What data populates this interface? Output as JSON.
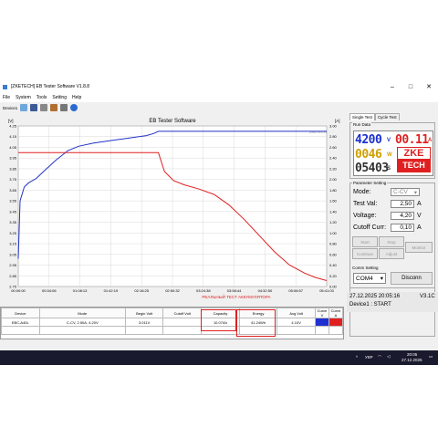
{
  "window": {
    "title": "[ZKETECH] EB Tester Software V1.8.8"
  },
  "menu": [
    "File",
    "System",
    "Tools",
    "Setting",
    "Help"
  ],
  "toolbar": {
    "device_label": "Device1"
  },
  "chart": {
    "title": "EB Tester Software",
    "watermark": "ZKETECH",
    "left_unit": "[V]",
    "right_unit": "[A]",
    "overlay_text": "РЕАЛЬНЫЙ ТЕСТ АККУМУЛЯТОРА",
    "colors": {
      "voltage": "#2233c8",
      "current": "#e02020",
      "grid": "#d0d0d0"
    }
  },
  "chart_data": {
    "type": "line",
    "title": "EB Tester Software",
    "x_ticks": [
      "00:00:00",
      "00:34:06",
      "01:08:13",
      "01:42:19",
      "02:16:25",
      "02:50:32",
      "03:24:38",
      "03:58:44",
      "04:32:50",
      "05:06:57",
      "05:41:03"
    ],
    "x_range_seconds": [
      0,
      20463
    ],
    "y_left_ticks": [
      "4.25",
      "4.15",
      "4.05",
      "3.95",
      "3.85",
      "3.75",
      "3.65",
      "3.55",
      "3.45",
      "3.35",
      "3.25",
      "3.15",
      "3.05",
      "2.95",
      "2.85",
      "2.75"
    ],
    "y_left_range": [
      2.75,
      4.25
    ],
    "y_right_ticks": [
      "3.00",
      "2.80",
      "2.60",
      "2.40",
      "2.20",
      "2.00",
      "1.80",
      "1.60",
      "1.40",
      "1.20",
      "1.00",
      "0.80",
      "0.60",
      "0.40",
      "0.20",
      "0.00"
    ],
    "y_right_range": [
      0,
      3.0
    ],
    "grid": true,
    "series": [
      {
        "axis": "left",
        "color": "#2233c8",
        "x": [
          0,
          120,
          400,
          700,
          1200,
          1800,
          2500,
          3300,
          4000,
          5000,
          6000,
          7000,
          8000,
          8500,
          9000,
          9300,
          20463
        ],
        "y": [
          3.01,
          3.55,
          3.68,
          3.72,
          3.76,
          3.84,
          3.93,
          4.02,
          4.06,
          4.09,
          4.11,
          4.13,
          4.15,
          4.16,
          4.18,
          4.2,
          4.2
        ]
      },
      {
        "axis": "right",
        "color": "#e02020",
        "x": [
          0,
          9300,
          9700,
          10300,
          11000,
          12000,
          13000,
          14000,
          15000,
          16000,
          17000,
          18000,
          19000,
          19700,
          20463
        ],
        "y": [
          2.5,
          2.5,
          2.15,
          1.98,
          1.9,
          1.82,
          1.72,
          1.52,
          1.25,
          0.95,
          0.65,
          0.4,
          0.25,
          0.17,
          0.11
        ]
      }
    ]
  },
  "table": {
    "headers": [
      "Device",
      "Mode",
      "Begin Volt",
      "Cutoff Volt",
      "Capacity",
      "Energy",
      "Avg Volt",
      "Curve V",
      "Curve A"
    ],
    "row": [
      "EBC-A40L",
      "C-CV, 2.50A, 4.20V",
      "3.011V",
      "",
      "10.07Ah",
      "41.24Wh",
      "4.10V",
      "",
      ""
    ],
    "curve_colors": [
      "#2030d0",
      "#e02020"
    ]
  },
  "tabs": [
    "Single Test",
    "Cycle Test"
  ],
  "run_data": {
    "label": "Run Data",
    "voltage": "4200",
    "voltage_unit": "V",
    "current": "00.11",
    "current_unit": "A",
    "power": "0046",
    "power_unit": "W",
    "time": "05403",
    "time_unit": "S",
    "logo_top": "ZKE",
    "logo_bottom": "TECH"
  },
  "params": {
    "label": "Parameter Setting",
    "mode_label": "Mode:",
    "mode_value": "C-CV",
    "test_val_label": "Test Val:",
    "test_val": "2,50",
    "test_val_unit": "A",
    "voltage_label": "Voltage:",
    "voltage_value": "4,20",
    "voltage_unit": "V",
    "cutoff_label": "Cutoff Curr:",
    "cutoff_value": "0,10",
    "cutoff_unit": "A",
    "buttons": {
      "start": "Start",
      "stop": "Stop",
      "continue": "Continue",
      "adjust": "Adjust",
      "monitor": "Monitor"
    }
  },
  "comm": {
    "label": "Comm Setting",
    "port": "COM4",
    "disconnect": "Disconn"
  },
  "status": {
    "datetime": "27.12.2025 20:05:16",
    "version": "V3.1C",
    "device_state": "Device1 : START"
  },
  "taskbar": {
    "lang": "УКР",
    "time": "20:05",
    "date": "27.12.2025"
  }
}
